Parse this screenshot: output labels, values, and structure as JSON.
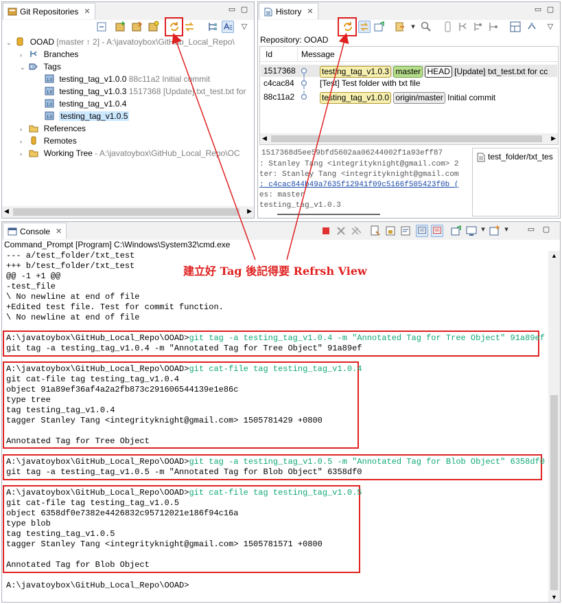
{
  "git_repos": {
    "title": "Git Repositories",
    "repo": {
      "name": "OOAD",
      "branch": "[master ↑ 2]",
      "path": "- A:\\javatoybox\\GitHub_Local_Repo\\"
    },
    "items": [
      {
        "label": "Branches"
      },
      {
        "label": "Tags"
      },
      {
        "label": "References"
      },
      {
        "label": "Remotes"
      },
      {
        "label": "Working Tree",
        "path": "- A:\\javatoybox\\GitHub_Local_Repo\\OC"
      }
    ],
    "tags": [
      {
        "name": "testing_tag_v1.0.0",
        "info": "88c11a2 Initial commit"
      },
      {
        "name": "testing_tag_v1.0.3",
        "info": "1517368 [Update] txt_test.txt for"
      },
      {
        "name": "testing_tag_v1.0.4",
        "info": ""
      },
      {
        "name": "testing_tag_v1.0.5",
        "info": ""
      }
    ]
  },
  "history": {
    "title": "History",
    "repository_label": "Repository: OOAD",
    "col_id": "Id",
    "col_message": "Message",
    "commits": [
      {
        "id": "1517368",
        "tags": [
          "testing_tag_v1.0.3"
        ],
        "master": "master",
        "head": "HEAD",
        "remote": "",
        "message": "[Update] txt_test.txt for cc"
      },
      {
        "id": "c4cac84",
        "tags": [],
        "master": "",
        "head": "",
        "remote": "",
        "message": "[Test] Test folder with txt file"
      },
      {
        "id": "88c11a2",
        "tags": [
          "testing_tag_v1.0.0"
        ],
        "master": "",
        "head": "",
        "remote": "origin/master",
        "message": "Initial commit"
      }
    ],
    "details": [
      "1517368d5ee59bfd5602aa06244002f1a93eff87",
      ": Stanley Tang <integrityknight@gmail.com> 2",
      "ter: Stanley Tang <integrityknight@gmail.com",
      ": c4cac844b49a7635f12941f09c5166f505423f0b (",
      "es: master",
      "testing_tag_v1.0.3"
    ],
    "file": "test_folder/txt_tes"
  },
  "console": {
    "title": "Console",
    "process": "Command_Prompt [Program] C:\\Windows\\System32\\cmd.exe",
    "diff_lines": [
      "--- a/test_folder/txt_test",
      "+++ b/test_folder/txt_test",
      "@@ -1 +1 @@",
      "-test_file",
      "\\ No newline at end of file",
      "+Edited test file. Test for commit function.",
      "\\ No newline at end of file"
    ],
    "prompt": "A:\\javatoybox\\GitHub_Local_Repo\\OOAD>",
    "block1": {
      "cmd": "git tag -a testing_tag_v1.0.4 -m \"Annotated Tag for Tree Object\" 91a89ef",
      "echo": "git tag -a testing_tag_v1.0.4 -m \"Annotated Tag for Tree Object\" 91a89ef"
    },
    "block2": {
      "cmd": "git cat-file tag testing_tag_v1.0.4",
      "lines": [
        "git cat-file tag testing_tag_v1.0.4",
        "object 91a89ef36af4a2a2fb873c291606544139e1e86c",
        "type tree",
        "tag testing_tag_v1.0.4",
        "tagger Stanley Tang <integrityknight@gmail.com> 1505781429 +0800",
        "",
        "Annotated Tag for Tree Object"
      ]
    },
    "block3": {
      "cmd": "git tag -a testing_tag_v1.0.5 -m \"Annotated Tag for Blob Object\" 6358df0",
      "echo": "git tag -a testing_tag_v1.0.5 -m \"Annotated Tag for Blob Object\" 6358df0"
    },
    "block4": {
      "cmd": "git cat-file tag testing_tag_v1.0.5",
      "lines": [
        "git cat-file tag testing_tag_v1.0.5",
        "object 6358df0e7382e4426832c95712021e186f94c16a",
        "type blob",
        "tag testing_tag_v1.0.5",
        "tagger Stanley Tang <integrityknight@gmail.com> 1505781571 +0800",
        "",
        "Annotated Tag for Blob Object"
      ]
    },
    "final_prompt": "A:\\javatoybox\\GitHub_Local_Repo\\OOAD>"
  },
  "annotation": {
    "text": "建立好 Tag 後記得要 Refrsh View",
    "color": "#e02020"
  },
  "colors": {
    "accent": "#e02020",
    "command": "#10a878",
    "selection": "#cce8ff"
  }
}
